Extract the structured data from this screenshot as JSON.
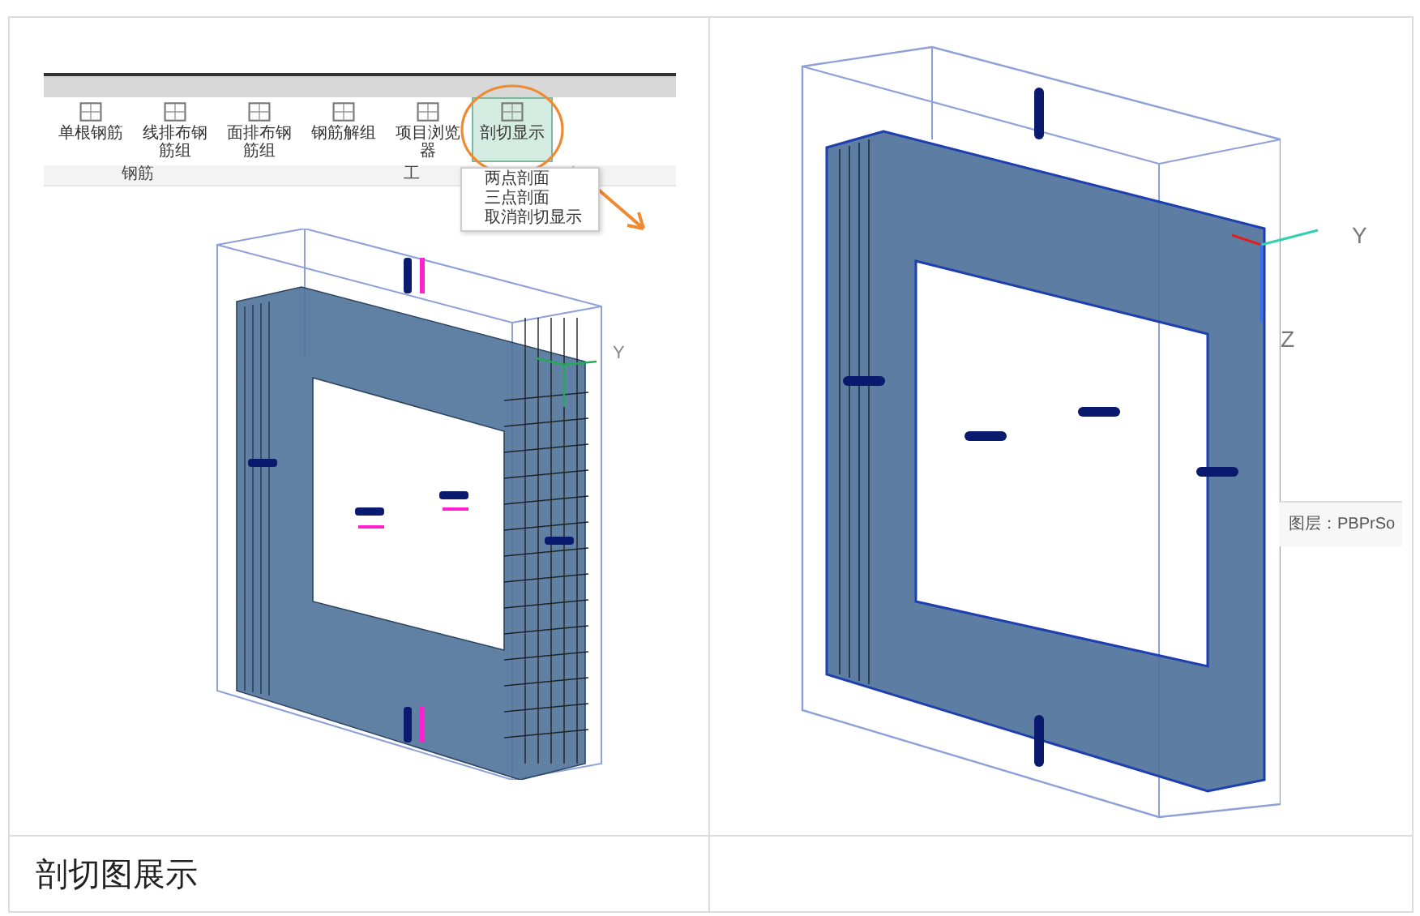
{
  "table": {
    "rows": [
      {
        "cells": [
          {
            "kind": "figure",
            "figure": {
              "ribbon": {
                "buttons": [
                  {
                    "label": "单根钢筋",
                    "selected": false
                  },
                  {
                    "label": "线排布钢筋组",
                    "selected": false
                  },
                  {
                    "label": "面排布钢筋组",
                    "selected": false
                  },
                  {
                    "label": "钢筋解组",
                    "selected": false
                  },
                  {
                    "label": "项目浏览器",
                    "selected": false
                  },
                  {
                    "label": "剖切显示",
                    "selected": true
                  }
                ],
                "groups": [
                  "钢筋",
                  "工"
                ],
                "menu": {
                  "items": [
                    "两点剖面",
                    "三点剖面",
                    "取消剖切显示"
                  ]
                }
              },
              "axis_labels": [
                "Y"
              ]
            }
          },
          {
            "kind": "figure",
            "figure": {
              "axis_labels": [
                "Y",
                "Z"
              ],
              "tooltip": "图层：PBPrSo"
            }
          }
        ]
      },
      {
        "cells": [
          {
            "kind": "text",
            "text": "剖切图展示"
          },
          {
            "kind": "empty"
          }
        ]
      }
    ]
  }
}
